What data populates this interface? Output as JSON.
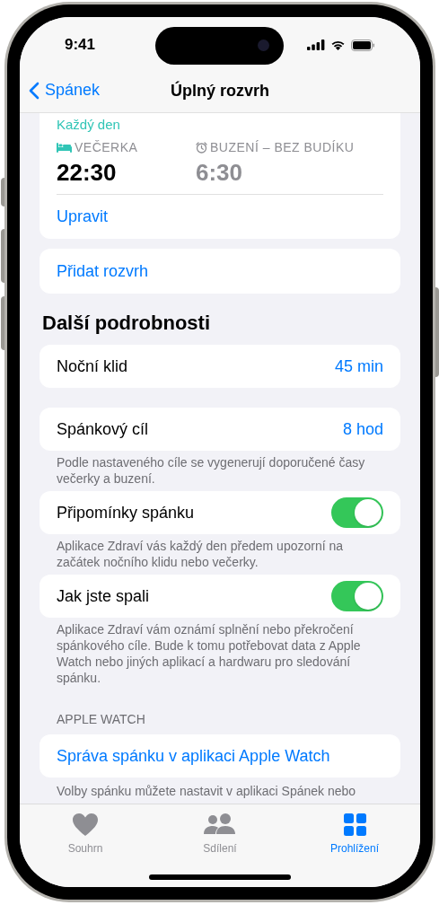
{
  "status_bar": {
    "time": "9:41"
  },
  "nav": {
    "back": "Spánek",
    "title": "Úplný rozvrh"
  },
  "schedule": {
    "days": "Každý den",
    "bedtime": {
      "label": "VEČERKA",
      "time": "22:30"
    },
    "wake": {
      "label": "BUZENÍ – BEZ BUDÍKU",
      "time": "6:30"
    },
    "edit": "Upravit"
  },
  "add_schedule": "Přidat rozvrh",
  "section_title": "Další podrobnosti",
  "rows": [
    {
      "kind": "value",
      "label": "Noční klid",
      "value": "45 min"
    },
    {
      "kind": "value",
      "label": "Spánkový cíl",
      "value": "8 hod",
      "footer": "Podle nastaveného cíle se vygenerují doporučené časy večerky a buzení."
    },
    {
      "kind": "toggle",
      "label": "Připomínky spánku",
      "on": true,
      "footer": "Aplikace Zdraví vás každý den předem upozorní na začátek nočního klidu nebo večerky."
    },
    {
      "kind": "toggle",
      "label": "Jak jste spali",
      "on": true,
      "footer": "Aplikace Zdraví vám oznámí splnění nebo překročení spánkového cíle. Bude k tomu potřebovat data z Apple Watch nebo jiných aplikací a hardwaru pro sledování spánku."
    }
  ],
  "apple_watch": {
    "header": "APPLE WATCH",
    "link": "Správa spánku v aplikaci Apple Watch",
    "footer": "Volby spánku můžete nastavit v aplikaci Spánek nebo"
  },
  "tabs": [
    {
      "kind": "heart",
      "label": "Souhrn",
      "selected": false
    },
    {
      "kind": "people",
      "label": "Sdílení",
      "selected": false
    },
    {
      "kind": "grid",
      "label": "Prohlížení",
      "selected": true
    }
  ]
}
